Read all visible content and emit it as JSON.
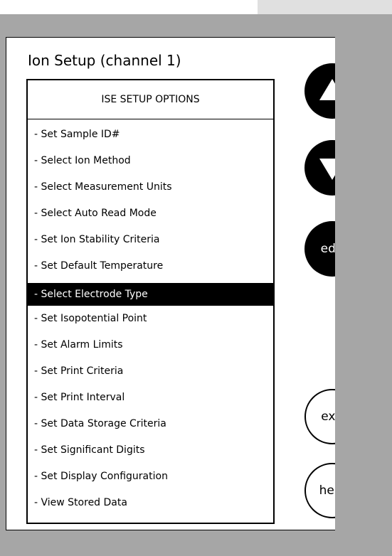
{
  "screen": {
    "title": "Ion Setup (channel 1)"
  },
  "options": {
    "header": "ISE SETUP OPTIONS",
    "selected_index": 6,
    "items": [
      {
        "label": "- Set Sample ID#"
      },
      {
        "label": "- Select Ion Method"
      },
      {
        "label": "- Select Measurement Units"
      },
      {
        "label": "- Select Auto Read Mode"
      },
      {
        "label": "- Set Ion Stability Criteria"
      },
      {
        "label": "- Set Default Temperature"
      },
      {
        "label": "- Select Electrode Type"
      },
      {
        "label": "- Set Isopotential Point"
      },
      {
        "label": "- Set Alarm Limits"
      },
      {
        "label": "- Set Print Criteria"
      },
      {
        "label": "- Set Print Interval"
      },
      {
        "label": "- Set Data Storage Criteria"
      },
      {
        "label": "- Set Significant Digits"
      },
      {
        "label": "- Set Display Configuration"
      },
      {
        "label": "- View Stored Data"
      }
    ]
  },
  "buttons": {
    "up_icon": "triangle-up-icon",
    "down_icon": "triangle-down-icon",
    "edit_label": "edit",
    "exit_label": "exit",
    "help_label": "help"
  },
  "colors": {
    "background_gray": "#a6a6a6",
    "panel": "#ffffff",
    "highlight": "#000000",
    "highlight_text": "#ffffff"
  }
}
